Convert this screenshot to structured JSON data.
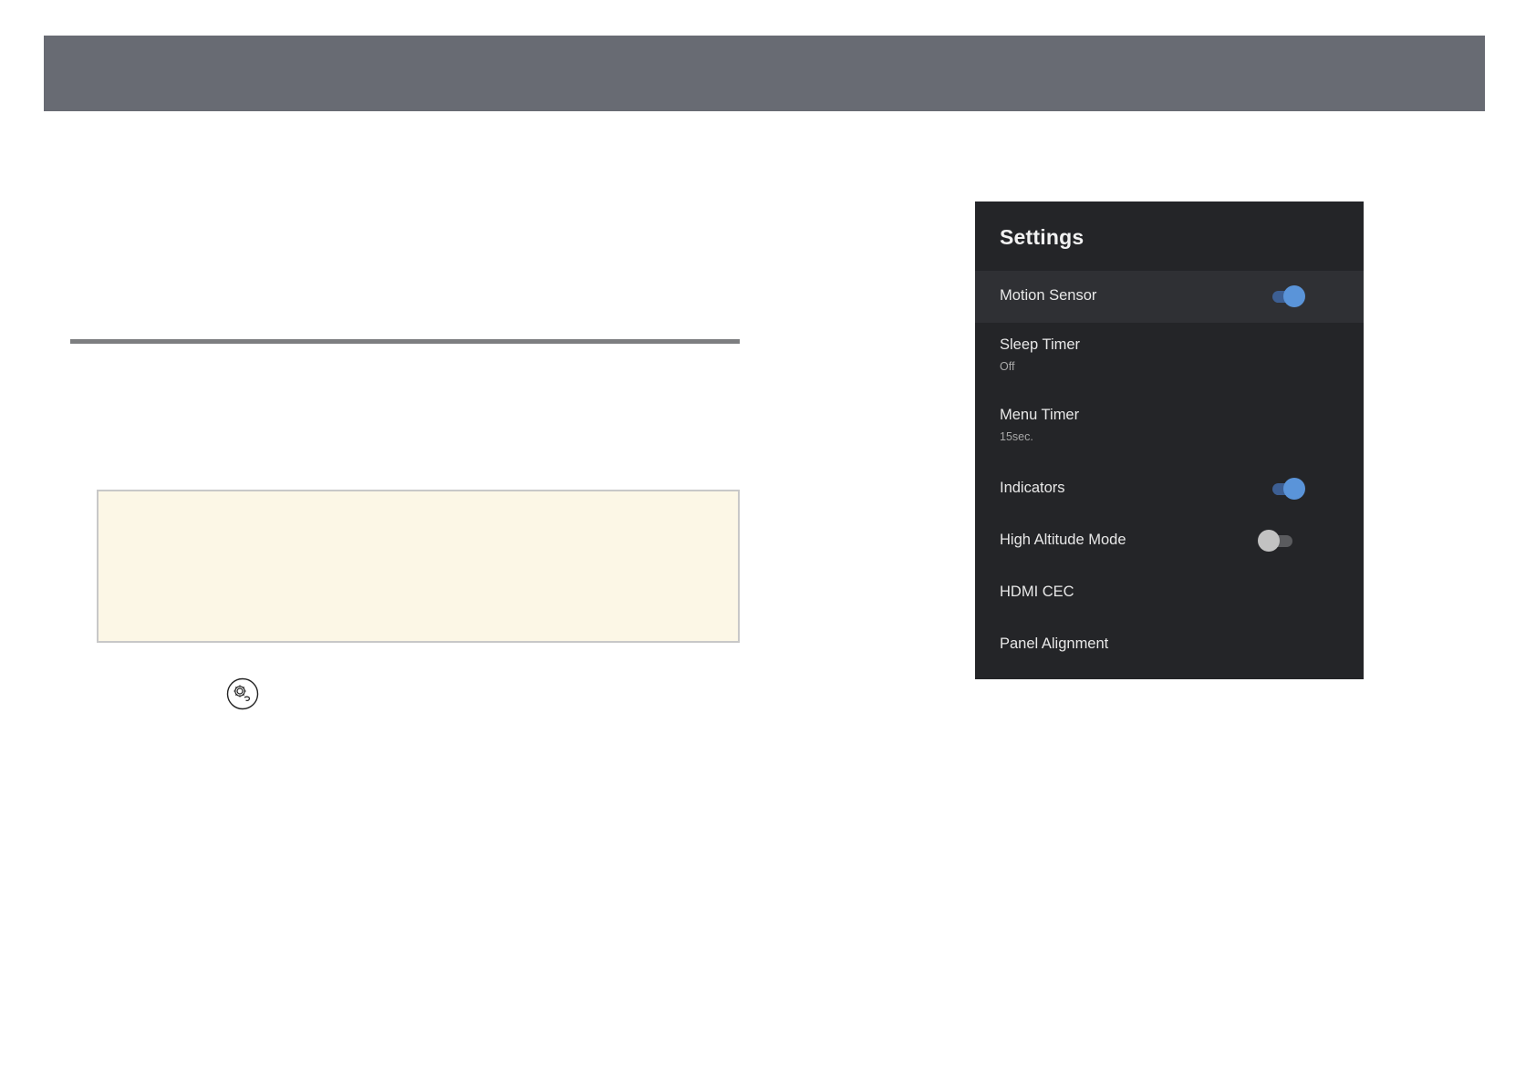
{
  "page_header": {
    "bar_color": "#686b73"
  },
  "note_box": {
    "background": "#fcf7e6"
  },
  "settings_button_icon": {
    "icon": "settings-gear-icon"
  },
  "settings_panel": {
    "title": "Settings",
    "items": [
      {
        "label": "Motion Sensor",
        "toggle": "on",
        "focused": true
      },
      {
        "label": "Sleep Timer",
        "value": "Off"
      },
      {
        "label": "Menu Timer",
        "value": "15sec."
      },
      {
        "label": "Indicators",
        "toggle": "on"
      },
      {
        "label": "High Altitude Mode",
        "toggle": "off"
      },
      {
        "label": "HDMI CEC"
      },
      {
        "label": "Panel Alignment"
      }
    ],
    "colors": {
      "panel_background": "#242528",
      "focused_row": "#2f3034",
      "toggle_on": "#5a94d9",
      "toggle_off": "#c2c2c2"
    }
  }
}
